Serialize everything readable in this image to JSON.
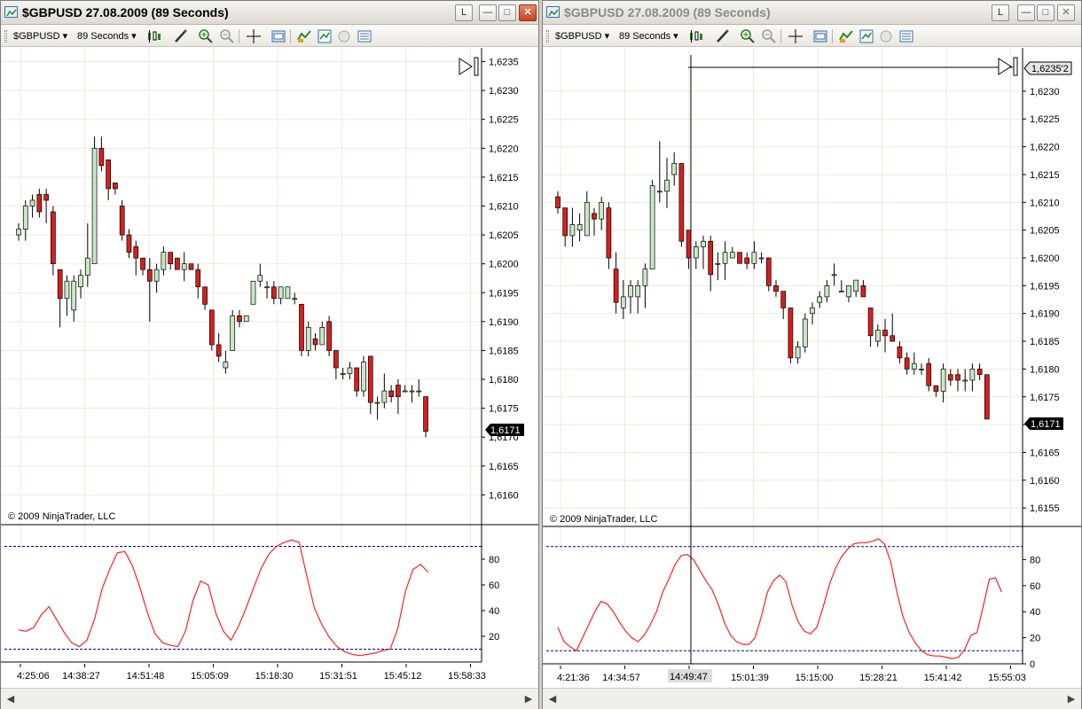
{
  "left": {
    "title": "$GBPUSD  27.08.2009 (89 Seconds)",
    "toolbar": {
      "instrument": "$GBPUSD",
      "period": "89 Seconds"
    },
    "copyright": "© 2009 NinjaTrader, LLC",
    "price_axis": [
      "1,6235",
      "1,6230",
      "1,6225",
      "1,6220",
      "1,6215",
      "1,6210",
      "1,6205",
      "1,6200",
      "1,6195",
      "1,6190",
      "1,6185",
      "1,6180",
      "1,6175",
      "1,6170",
      "1,6165",
      "1,6160"
    ],
    "last_price": "1,6171",
    "osc_axis": [
      "80",
      "60",
      "40",
      "20"
    ],
    "time_axis": [
      "4:25:06",
      "14:38:27",
      "14:51:48",
      "15:05:09",
      "15:18:30",
      "15:31:51",
      "15:45:12",
      "15:58:33"
    ]
  },
  "right": {
    "title": "$GBPUSD  27.08.2009 (89 Seconds)",
    "toolbar": {
      "instrument": "$GBPUSD",
      "period": "89 Seconds"
    },
    "copyright": "© 2009 NinjaTrader, LLC",
    "price_axis": [
      "1,6230",
      "1,6225",
      "1,6220",
      "1,6215",
      "1,6210",
      "1,6205",
      "1,6200",
      "1,6195",
      "1,6190",
      "1,6185",
      "1,6180",
      "1,6175",
      "1,6170",
      "1,6165",
      "1,6160",
      "1,6155"
    ],
    "last_price": "1,6171",
    "crosshair_price": "1,6235'2",
    "crosshair_time": "14:49:47",
    "osc_axis": [
      "80",
      "60",
      "40",
      "20",
      "0"
    ],
    "time_axis": [
      "4:21:36",
      "14:34:57",
      "14:49:47",
      "15:01:39",
      "15:15:00",
      "15:28:21",
      "15:41:42",
      "15:55:03"
    ]
  },
  "icons": [
    "chart-window-icon",
    "minimize-icon",
    "maximize-icon",
    "close-icon",
    "bar-type-icon",
    "drawing-tool-icon",
    "zoom-in-icon",
    "zoom-out-icon",
    "crosshair-icon",
    "properties-icon",
    "indicators-icon",
    "strategies-icon",
    "data-box-icon",
    "chart-trader-icon"
  ],
  "colors": {
    "bull": "#c9e8c5",
    "bear": "#d81e1e",
    "oscillator": "#ff2020",
    "levels": "#0000aa",
    "grid": "#efe9d8"
  },
  "chart_data": [
    {
      "type": "candlestick",
      "title": "$GBPUSD  27.08.2009 (89 Seconds)",
      "ylim": [
        1.6155,
        1.6236
      ],
      "last": 1.6171,
      "bars": [
        [
          1.6205,
          1.6207,
          1.6204,
          1.6206
        ],
        [
          1.6206,
          1.6211,
          1.6204,
          1.621
        ],
        [
          1.621,
          1.6212,
          1.6208,
          1.6211
        ],
        [
          1.6212,
          1.6213,
          1.6208,
          1.6209
        ],
        [
          1.6212,
          1.6213,
          1.6207,
          1.6211
        ],
        [
          1.6209,
          1.621,
          1.6198,
          1.62
        ],
        [
          1.6199,
          1.6199,
          1.6189,
          1.6194
        ],
        [
          1.6194,
          1.6198,
          1.6191,
          1.6197
        ],
        [
          1.6192,
          1.6198,
          1.619,
          1.6197
        ],
        [
          1.6196,
          1.6199,
          1.6194,
          1.6198
        ],
        [
          1.6198,
          1.6207,
          1.6196,
          1.6201
        ],
        [
          1.62,
          1.6222,
          1.62,
          1.622
        ],
        [
          1.622,
          1.6222,
          1.6216,
          1.6217
        ],
        [
          1.6218,
          1.6218,
          1.6211,
          1.6213
        ],
        [
          1.6214,
          1.6214,
          1.6212,
          1.6213
        ],
        [
          1.621,
          1.6211,
          1.6204,
          1.6205
        ],
        [
          1.6205,
          1.6206,
          1.6201,
          1.6202
        ],
        [
          1.6203,
          1.6204,
          1.6198,
          1.6201
        ],
        [
          1.6201,
          1.6201,
          1.6198,
          1.6199
        ],
        [
          1.6199,
          1.6201,
          1.619,
          1.6197
        ],
        [
          1.6197,
          1.62,
          1.6195,
          1.6199
        ],
        [
          1.6199,
          1.6203,
          1.6198,
          1.6202
        ],
        [
          1.6202,
          1.6202,
          1.6199,
          1.62
        ],
        [
          1.6201,
          1.6201,
          1.6199,
          1.6199
        ],
        [
          1.6199,
          1.6202,
          1.6197,
          1.62
        ],
        [
          1.62,
          1.62,
          1.6199,
          1.6199
        ],
        [
          1.6199,
          1.62,
          1.6194,
          1.6196
        ],
        [
          1.6196,
          1.6196,
          1.6192,
          1.6193
        ],
        [
          1.6192,
          1.6192,
          1.6185,
          1.6186
        ],
        [
          1.6186,
          1.6188,
          1.6183,
          1.6184
        ],
        [
          1.6182,
          1.6185,
          1.6181,
          1.6183
        ],
        [
          1.6185,
          1.6192,
          1.6185,
          1.6191
        ],
        [
          1.6191,
          1.6192,
          1.6189,
          1.619
        ],
        [
          1.619,
          1.6191,
          1.619,
          1.6191
        ],
        [
          1.6193,
          1.6197,
          1.6193,
          1.6197
        ],
        [
          1.6197,
          1.62,
          1.6196,
          1.6198
        ],
        [
          1.6196,
          1.6197,
          1.6194,
          1.6196
        ],
        [
          1.6196,
          1.6197,
          1.6193,
          1.6194
        ],
        [
          1.6194,
          1.6196,
          1.6193,
          1.6196
        ],
        [
          1.6194,
          1.6196,
          1.6194,
          1.6196
        ],
        [
          1.6194,
          1.6195,
          1.6193,
          1.6194
        ],
        [
          1.6193,
          1.6193,
          1.6184,
          1.6185
        ],
        [
          1.6185,
          1.619,
          1.6184,
          1.6189
        ],
        [
          1.6187,
          1.6188,
          1.6185,
          1.6186
        ],
        [
          1.6186,
          1.619,
          1.6186,
          1.6189
        ],
        [
          1.619,
          1.6191,
          1.6184,
          1.6185
        ],
        [
          1.6185,
          1.6185,
          1.618,
          1.6182
        ],
        [
          1.6181,
          1.6182,
          1.618,
          1.6181
        ],
        [
          1.6181,
          1.6183,
          1.618,
          1.6182
        ],
        [
          1.6182,
          1.6182,
          1.6177,
          1.6178
        ],
        [
          1.6178,
          1.6184,
          1.6177,
          1.6183
        ],
        [
          1.6184,
          1.6184,
          1.6174,
          1.6176
        ],
        [
          1.6176,
          1.6177,
          1.6173,
          1.6176
        ],
        [
          1.6176,
          1.6181,
          1.6175,
          1.6178
        ],
        [
          1.6178,
          1.6179,
          1.6176,
          1.6177
        ],
        [
          1.6179,
          1.618,
          1.6174,
          1.6177
        ],
        [
          1.6178,
          1.6179,
          1.6178,
          1.6178
        ],
        [
          1.6178,
          1.6179,
          1.6176,
          1.6178
        ],
        [
          1.6178,
          1.618,
          1.6177,
          1.6178
        ],
        [
          1.6177,
          1.6177,
          1.617,
          1.6171
        ]
      ]
    },
    {
      "type": "line",
      "title": "oscillator",
      "ylim": [
        0,
        100
      ],
      "levels": [
        90,
        10
      ],
      "values": [
        25,
        24,
        27,
        37,
        43,
        33,
        23,
        15,
        12,
        17,
        33,
        57,
        72,
        85,
        86,
        75,
        58,
        38,
        22,
        15,
        13,
        12,
        24,
        48,
        63,
        60,
        38,
        24,
        17,
        28,
        42,
        58,
        73,
        84,
        90,
        93,
        95,
        93,
        67,
        42,
        29,
        19,
        12,
        8,
        6,
        5,
        6,
        7,
        9,
        10,
        26,
        55,
        72,
        76,
        70
      ]
    },
    {
      "type": "candlestick",
      "title": "$GBPUSD  27.08.2009 (89 Seconds)",
      "ylim": [
        1.6152,
        1.6237
      ],
      "last": 1.6171,
      "crosshair_price": 1.62352,
      "bars": [
        [
          1.6211,
          1.6212,
          1.6208,
          1.6209
        ],
        [
          1.6209,
          1.6209,
          1.6202,
          1.6204
        ],
        [
          1.6204,
          1.6209,
          1.6202,
          1.6206
        ],
        [
          1.6205,
          1.6208,
          1.6203,
          1.6206
        ],
        [
          1.6204,
          1.6212,
          1.6204,
          1.621
        ],
        [
          1.6208,
          1.6209,
          1.6204,
          1.6207
        ],
        [
          1.6207,
          1.6211,
          1.6205,
          1.621
        ],
        [
          1.6209,
          1.621,
          1.6198,
          1.62
        ],
        [
          1.6198,
          1.6201,
          1.619,
          1.6192
        ],
        [
          1.6191,
          1.6196,
          1.6189,
          1.6193
        ],
        [
          1.6193,
          1.6196,
          1.619,
          1.6195
        ],
        [
          1.6193,
          1.6196,
          1.619,
          1.6195
        ],
        [
          1.6195,
          1.6199,
          1.6191,
          1.6198
        ],
        [
          1.6198,
          1.6214,
          1.6198,
          1.6213
        ],
        [
          1.6212,
          1.6221,
          1.621,
          1.6212
        ],
        [
          1.6212,
          1.6218,
          1.6209,
          1.6214
        ],
        [
          1.6215,
          1.6219,
          1.6213,
          1.6217
        ],
        [
          1.6217,
          1.6217,
          1.6202,
          1.6203
        ],
        [
          1.6205,
          1.6205,
          1.6198,
          1.62
        ],
        [
          1.62,
          1.6203,
          1.6198,
          1.6202
        ],
        [
          1.6202,
          1.6204,
          1.6198,
          1.6203
        ],
        [
          1.6203,
          1.6204,
          1.6194,
          1.6197
        ],
        [
          1.6199,
          1.6201,
          1.6196,
          1.6199
        ],
        [
          1.6199,
          1.6203,
          1.6196,
          1.6201
        ],
        [
          1.62,
          1.6202,
          1.62,
          1.6201
        ],
        [
          1.6201,
          1.6201,
          1.6199,
          1.6199
        ],
        [
          1.62,
          1.6201,
          1.6198,
          1.6199
        ],
        [
          1.6199,
          1.6203,
          1.6198,
          1.6201
        ],
        [
          1.62,
          1.6201,
          1.6199,
          1.62
        ],
        [
          1.62,
          1.62,
          1.6194,
          1.6195
        ],
        [
          1.6195,
          1.6196,
          1.6193,
          1.6194
        ],
        [
          1.6194,
          1.6194,
          1.6189,
          1.6191
        ],
        [
          1.6191,
          1.6191,
          1.6181,
          1.6182
        ],
        [
          1.6182,
          1.6185,
          1.6181,
          1.6184
        ],
        [
          1.6184,
          1.619,
          1.6183,
          1.6189
        ],
        [
          1.619,
          1.6192,
          1.6188,
          1.6191
        ],
        [
          1.6192,
          1.6194,
          1.6191,
          1.6193
        ],
        [
          1.6193,
          1.6196,
          1.6192,
          1.6195
        ],
        [
          1.6197,
          1.6199,
          1.6195,
          1.6197
        ],
        [
          1.6194,
          1.6196,
          1.6194,
          1.6194
        ],
        [
          1.6193,
          1.6195,
          1.6192,
          1.6195
        ],
        [
          1.6194,
          1.6196,
          1.6193,
          1.6196
        ],
        [
          1.6195,
          1.6196,
          1.6193,
          1.6193
        ],
        [
          1.6191,
          1.6191,
          1.6184,
          1.6186
        ],
        [
          1.6185,
          1.6188,
          1.6184,
          1.6187
        ],
        [
          1.6187,
          1.6189,
          1.6183,
          1.6186
        ],
        [
          1.6186,
          1.619,
          1.6185,
          1.6185
        ],
        [
          1.6184,
          1.6185,
          1.6181,
          1.6182
        ],
        [
          1.6182,
          1.6183,
          1.6179,
          1.618
        ],
        [
          1.618,
          1.6183,
          1.6179,
          1.6181
        ],
        [
          1.618,
          1.6181,
          1.6179,
          1.618
        ],
        [
          1.6181,
          1.6182,
          1.6176,
          1.6177
        ],
        [
          1.6177,
          1.6177,
          1.6175,
          1.6176
        ],
        [
          1.6176,
          1.6181,
          1.6174,
          1.618
        ],
        [
          1.6179,
          1.618,
          1.6177,
          1.6178
        ],
        [
          1.6179,
          1.618,
          1.6176,
          1.6178
        ],
        [
          1.6178,
          1.618,
          1.6176,
          1.6178
        ],
        [
          1.6178,
          1.6181,
          1.6176,
          1.618
        ],
        [
          1.618,
          1.6181,
          1.6178,
          1.6179
        ],
        [
          1.6179,
          1.6179,
          1.6171,
          1.6171
        ]
      ]
    },
    {
      "type": "line",
      "title": "oscillator",
      "ylim": [
        0,
        100
      ],
      "levels": [
        90,
        10
      ],
      "values": [
        28,
        17,
        13,
        10,
        20,
        30,
        40,
        48,
        46,
        40,
        32,
        25,
        20,
        17,
        22,
        30,
        40,
        55,
        65,
        76,
        83,
        84,
        80,
        72,
        64,
        57,
        46,
        32,
        22,
        17,
        15,
        15,
        20,
        36,
        55,
        64,
        68,
        63,
        45,
        32,
        25,
        23,
        28,
        43,
        60,
        73,
        82,
        88,
        92,
        93,
        93,
        94,
        96,
        92,
        78,
        55,
        36,
        24,
        16,
        10,
        7,
        6,
        6,
        5,
        4,
        5,
        11,
        22,
        24,
        44,
        65,
        66,
        55
      ]
    }
  ]
}
